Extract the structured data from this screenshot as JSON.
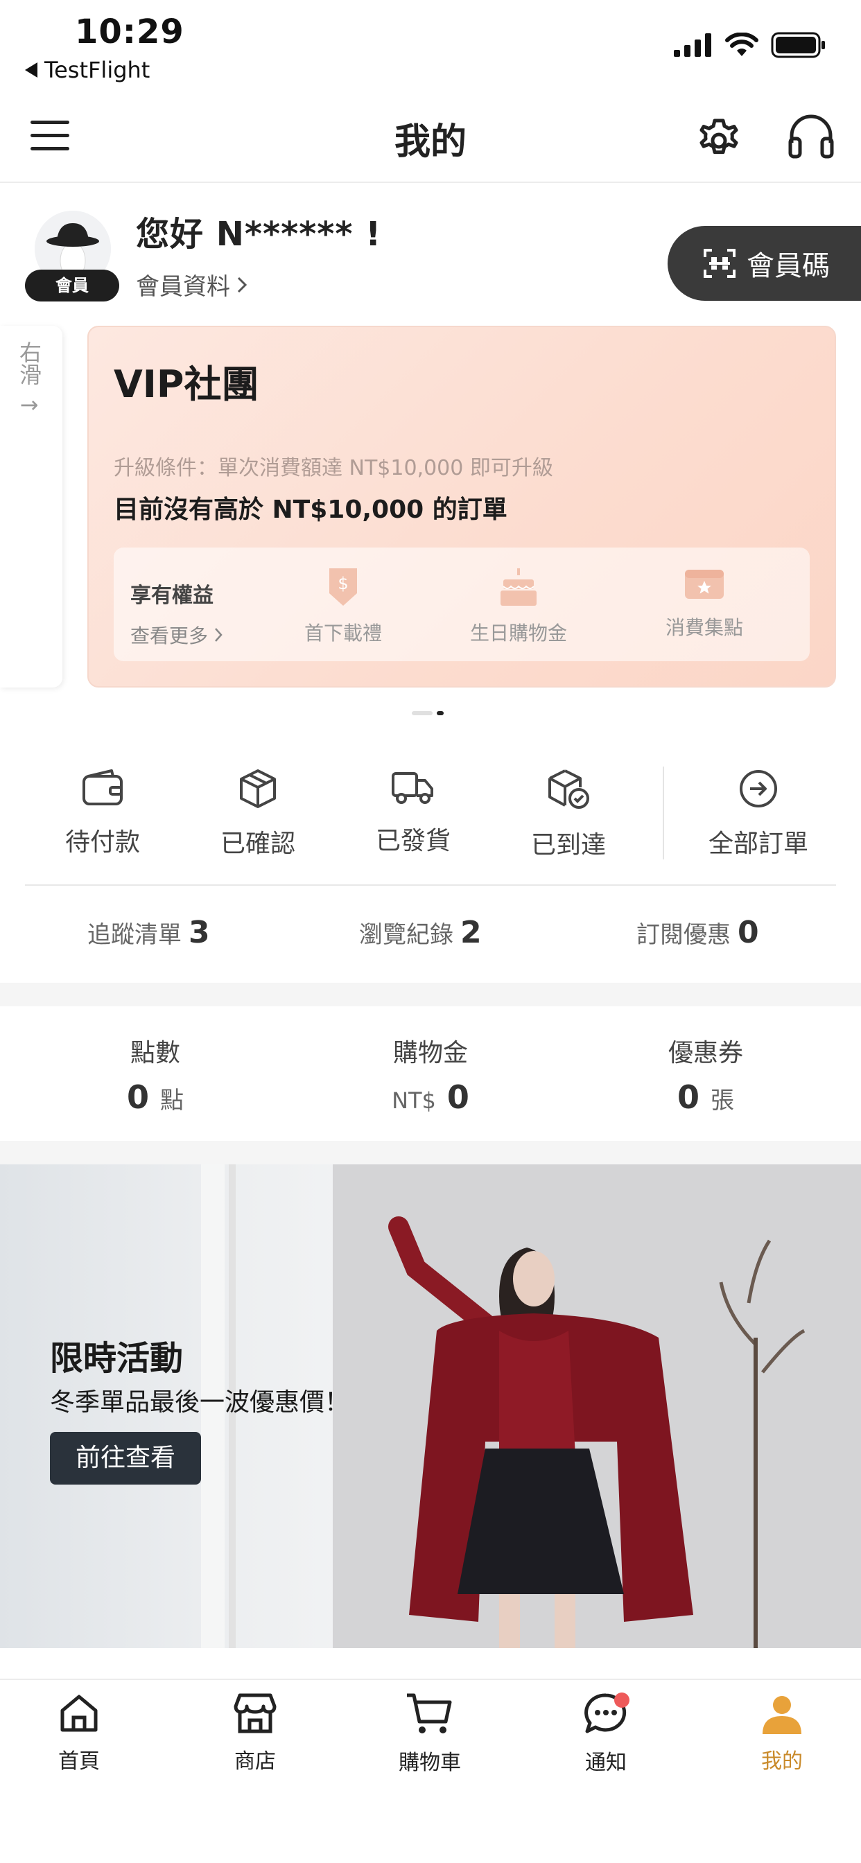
{
  "status_bar": {
    "time": "10:29",
    "back_app": "TestFlight"
  },
  "header": {
    "title": "我的"
  },
  "profile": {
    "greeting": "您好 N****** !",
    "member_badge": "會員",
    "member_info_link": "會員資料",
    "member_code_button": "會員碼"
  },
  "swipe_hint": {
    "text": "右滑",
    "arrow": "→"
  },
  "vip_card": {
    "title": "VIP社團",
    "condition": "升級條件：單次消費額達 NT$10,000 即可升級",
    "status": "目前沒有高於 NT$10,000 的訂單",
    "benefits_title": "享有權益",
    "see_more": "查看更多",
    "benefits": [
      {
        "label": "首下載禮",
        "icon": "download-gift-icon"
      },
      {
        "label": "生日購物金",
        "icon": "birthday-cake-icon"
      },
      {
        "label": "消費集點",
        "icon": "points-ticket-icon"
      }
    ]
  },
  "pager": {
    "total": 2,
    "active_index": 1
  },
  "orders": [
    {
      "label": "待付款",
      "icon": "wallet-icon"
    },
    {
      "label": "已確認",
      "icon": "box-icon"
    },
    {
      "label": "已發貨",
      "icon": "truck-icon"
    },
    {
      "label": "已到達",
      "icon": "box-check-icon"
    },
    {
      "label": "全部訂單",
      "icon": "arrow-circle-icon"
    }
  ],
  "stats": [
    {
      "label": "追蹤清單",
      "count": "3"
    },
    {
      "label": "瀏覽紀錄",
      "count": "2"
    },
    {
      "label": "訂閱優惠",
      "count": "0"
    }
  ],
  "wallet": {
    "points": {
      "label": "點數",
      "value": "0",
      "unit": "點"
    },
    "credit": {
      "label": "購物金",
      "prefix": "NT$",
      "value": "0"
    },
    "coupons": {
      "label": "優惠券",
      "value": "0",
      "unit": "張"
    }
  },
  "banner": {
    "title": "限時活動",
    "subtitle": "冬季單品最後一波優惠價！",
    "button": "前往查看"
  },
  "tabbar": [
    {
      "label": "首頁",
      "icon": "home-icon",
      "active": false
    },
    {
      "label": "商店",
      "icon": "store-icon",
      "active": false
    },
    {
      "label": "購物車",
      "icon": "cart-icon",
      "active": false
    },
    {
      "label": "通知",
      "icon": "chat-icon",
      "active": false
    },
    {
      "label": "我的",
      "icon": "person-icon",
      "active": true
    }
  ],
  "colors": {
    "accent": "#c98a2a",
    "vip_bg": "#fcdccf",
    "notif_dot": "#ee5a5a",
    "dark_button": "#2a323b"
  }
}
